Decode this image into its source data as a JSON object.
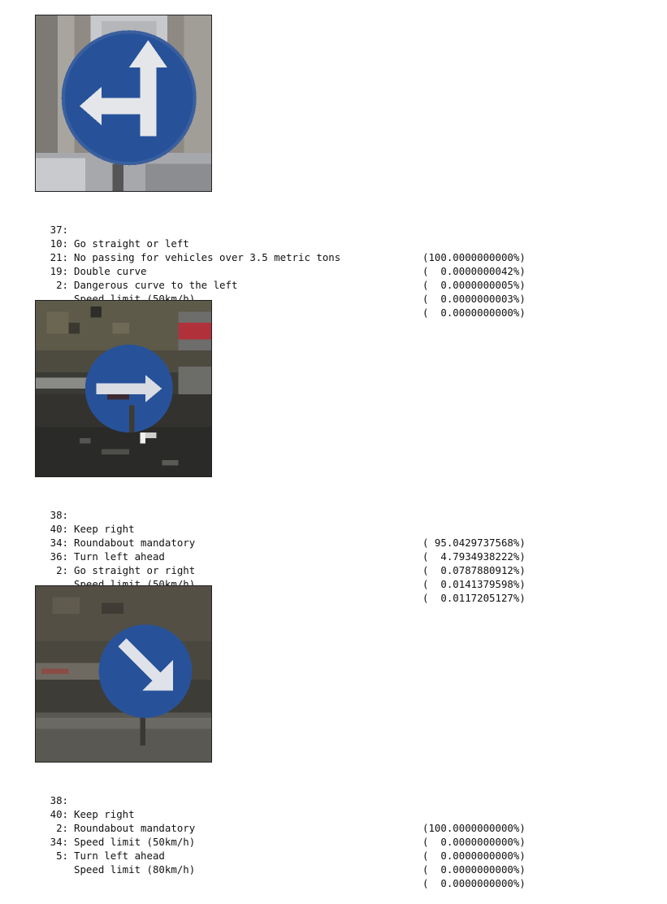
{
  "results": [
    {
      "image_description": "Go straight or left sign (blue circle with white arrows)",
      "predictions": [
        {
          "class_id": "37:",
          "label": "Go straight or left",
          "probability": "(100.0000000000%)"
        },
        {
          "class_id": "10:",
          "label": "No passing for vehicles over 3.5 metric tons",
          "probability": "(  0.0000000042%)"
        },
        {
          "class_id": "21:",
          "label": "Double curve",
          "probability": "(  0.0000000005%)"
        },
        {
          "class_id": "19:",
          "label": "Dangerous curve to the left",
          "probability": "(  0.0000000003%)"
        },
        {
          "class_id": "2:",
          "label": "Speed limit (50km/h)",
          "probability": "(  0.0000000000%)"
        }
      ]
    },
    {
      "image_description": "Keep right sign in dark street scene",
      "predictions": [
        {
          "class_id": "38:",
          "label": "Keep right",
          "probability": "( 95.0429737568%)"
        },
        {
          "class_id": "40:",
          "label": "Roundabout mandatory",
          "probability": "(  4.7934938222%)"
        },
        {
          "class_id": "34:",
          "label": "Turn left ahead",
          "probability": "(  0.0787880912%)"
        },
        {
          "class_id": "36:",
          "label": "Go straight or right",
          "probability": "(  0.0141379598%)"
        },
        {
          "class_id": "2:",
          "label": "Speed limit (50km/h)",
          "probability": "(  0.0117205127%)"
        }
      ]
    },
    {
      "image_description": "Keep right sign with diagonal arrow",
      "predictions": [
        {
          "class_id": "38:",
          "label": "Keep right",
          "probability": "(100.0000000000%)"
        },
        {
          "class_id": "40:",
          "label": "Roundabout mandatory",
          "probability": "(  0.0000000000%)"
        },
        {
          "class_id": "2:",
          "label": "Speed limit (50km/h)",
          "probability": "(  0.0000000000%)"
        },
        {
          "class_id": "34:",
          "label": "Turn left ahead",
          "probability": "(  0.0000000000%)"
        },
        {
          "class_id": "5:",
          "label": "Speed limit (80km/h)",
          "probability": "(  0.0000000000%)"
        }
      ]
    }
  ],
  "colors": {
    "sign_blue": "#27529a",
    "arrow_white": "#e4e6ea"
  }
}
